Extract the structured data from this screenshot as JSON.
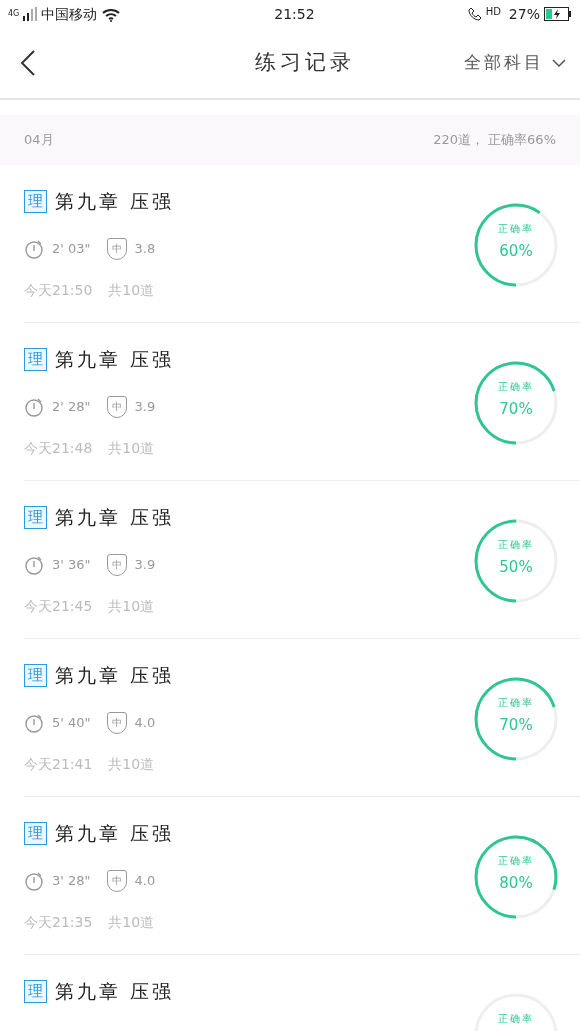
{
  "status_bar": {
    "network": "4G",
    "carrier": "中国移动",
    "time": "21:52",
    "hd": "HD",
    "battery": "27%"
  },
  "header": {
    "title": "练习记录",
    "filter": "全部科目"
  },
  "month": {
    "label": "04月",
    "summary": "220道， 正确率66%"
  },
  "records": [
    {
      "subject": "理",
      "title": "第九章 压强",
      "duration": "2' 03\"",
      "difficulty_mark": "中",
      "difficulty": "3.8",
      "time": "今天21:50",
      "count": "共10道",
      "rate_label": "正确率",
      "rate": "60%"
    },
    {
      "subject": "理",
      "title": "第九章 压强",
      "duration": "2' 28\"",
      "difficulty_mark": "中",
      "difficulty": "3.9",
      "time": "今天21:48",
      "count": "共10道",
      "rate_label": "正确率",
      "rate": "70%"
    },
    {
      "subject": "理",
      "title": "第九章 压强",
      "duration": "3' 36\"",
      "difficulty_mark": "中",
      "difficulty": "3.9",
      "time": "今天21:45",
      "count": "共10道",
      "rate_label": "正确率",
      "rate": "50%"
    },
    {
      "subject": "理",
      "title": "第九章 压强",
      "duration": "5' 40\"",
      "difficulty_mark": "中",
      "difficulty": "4.0",
      "time": "今天21:41",
      "count": "共10道",
      "rate_label": "正确率",
      "rate": "70%"
    },
    {
      "subject": "理",
      "title": "第九章 压强",
      "duration": "3' 28\"",
      "difficulty_mark": "中",
      "difficulty": "4.0",
      "time": "今天21:35",
      "count": "共10道",
      "rate_label": "正确率",
      "rate": "80%"
    },
    {
      "subject": "理",
      "title": "第九章 压强",
      "rate_label": "正确率"
    }
  ]
}
